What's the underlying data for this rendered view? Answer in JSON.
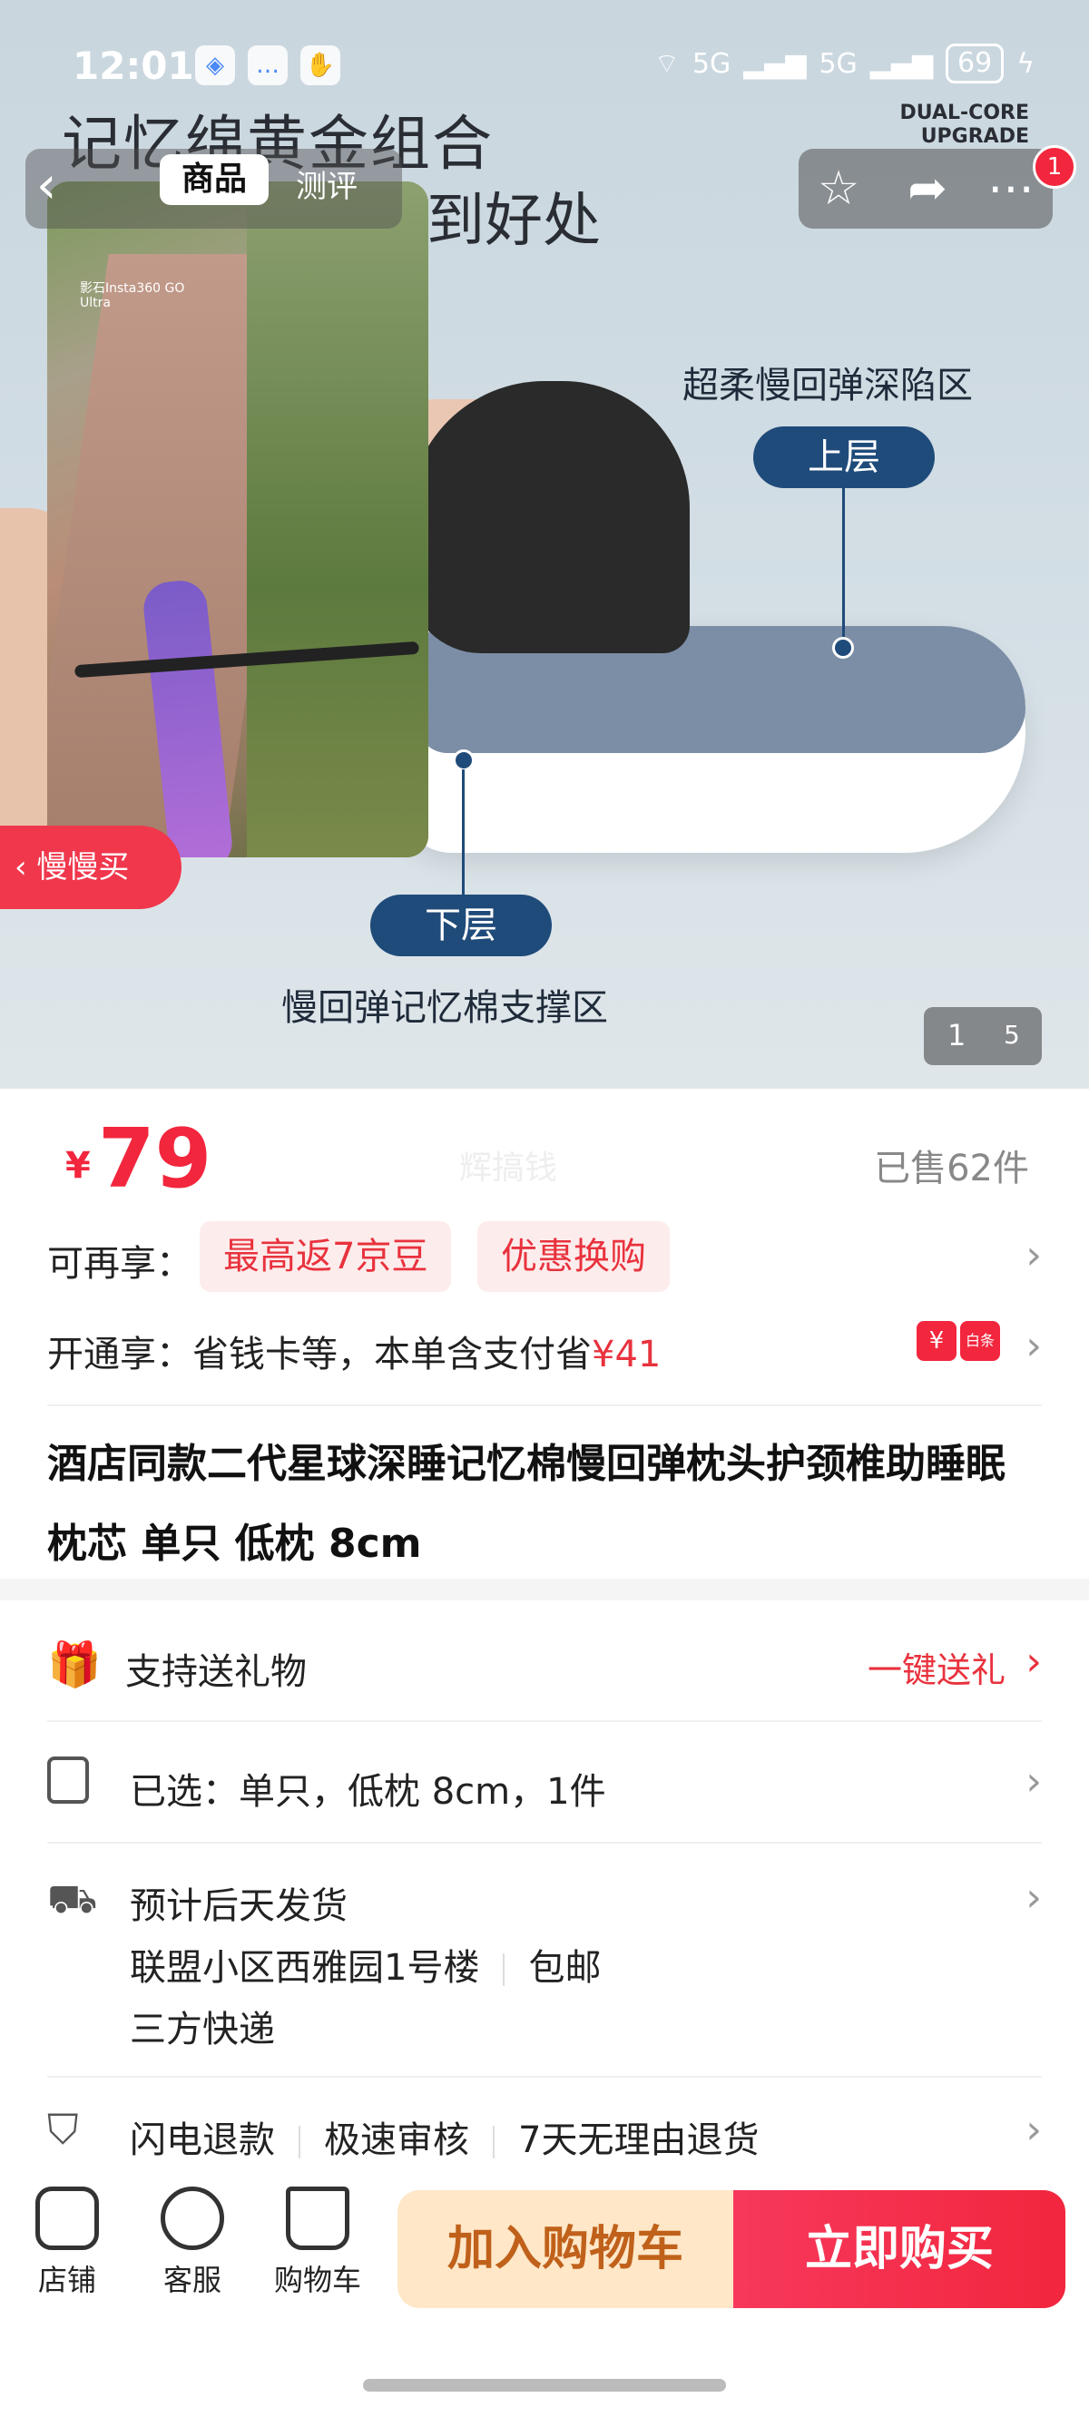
{
  "status_bar": {
    "time": "12:01",
    "battery": "69",
    "network": "5G",
    "upgrade": "DUAL-CORE UPGRADE"
  },
  "hero": {
    "title_line1": "记忆绵黄金组合",
    "title_line2": "到好处",
    "upper_desc": "超柔慢回弹深陷区",
    "upper_tag": "上层",
    "lower_tag": "下层",
    "lower_desc": "慢回弹记忆棉支撑区",
    "tab_active": "商品",
    "tab_other": "测评",
    "slow_button": "慢慢买",
    "pager_current": "1",
    "pager_total": "5",
    "cart_badge": "1",
    "video_watermark": "影石Insta360 GO Ultra"
  },
  "price": {
    "currency": "¥",
    "amount": "79",
    "watermark": "辉搞钱",
    "sold": "已售62件"
  },
  "promo": {
    "label": "可再享：",
    "chip1": "最高返7京豆",
    "chip2": "优惠换购"
  },
  "open": {
    "text": "开通享：省钱卡等，本单含支付省",
    "amount": "¥41",
    "badge_text": "白条"
  },
  "product_title": "酒店同款二代星球深睡记忆棉慢回弹枕头护颈椎助睡眠枕芯 单只 低枕 8cm",
  "gift": {
    "label": "支持送礼物",
    "action": "一键送礼"
  },
  "selected": {
    "text": "已选：单只，低枕 8cm，1件"
  },
  "delivery": {
    "line1": "预计后天发货",
    "address": "联盟小区西雅园1号楼",
    "shipping": "包邮",
    "carrier": "三方快递"
  },
  "service": {
    "item1": "闪电退款",
    "item2": "极速审核",
    "item3": "7天无理由退货"
  },
  "bottom_nav": {
    "store": "店铺",
    "service": "客服",
    "cart": "购物车",
    "add_cart": "加入购物车",
    "buy_now": "立即购买"
  }
}
